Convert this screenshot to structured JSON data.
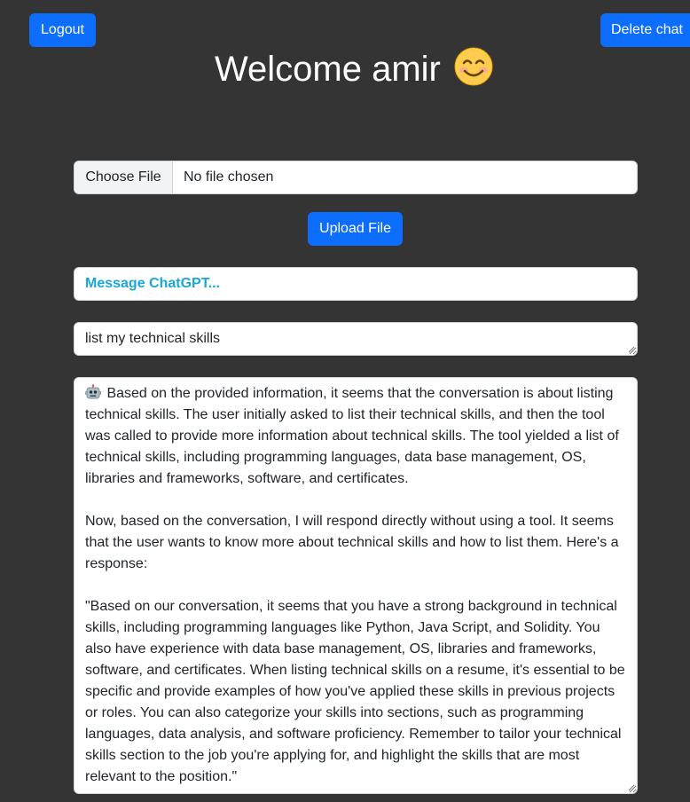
{
  "header": {
    "logout_label": "Logout",
    "delete_chat_label": "Delete chat",
    "welcome_text": "Welcome amir",
    "welcome_emoji_icon": "smiling-face-icon"
  },
  "upload": {
    "choose_file_label": "Choose File",
    "file_status": "No file chosen",
    "upload_button_label": "Upload File"
  },
  "chat": {
    "message_label": "Message ChatGPT...",
    "prompt_value": "list my technical skills",
    "response_icon": "robot-icon",
    "response_paragraphs": [
      "Based on the provided information, it seems that the conversation is about listing technical skills. The user initially asked to list their technical skills, and then the tool was called to provide more information about technical skills. The tool yielded a list of technical skills, including programming languages, data base management, OS, libraries and frameworks, software, and certificates.",
      "Now, based on the conversation, I will respond directly without using a tool. It seems that the user wants to know more about technical skills and how to list them. Here's a response:",
      "\"Based on our conversation, it seems that you have a strong background in technical skills, including programming languages like Python, Java Script, and Solidity. You also have experience with data base management, OS, libraries and frameworks, software, and certificates. When listing technical skills on a resume, it's essential to be specific and provide examples of how you've applied these skills in previous projects or roles. You can also categorize your skills into sections, such as programming languages, data analysis, and software proficiency. Remember to tailor your technical skills section to the job you're applying for, and highlight the skills that are most relevant to the position.\""
    ]
  },
  "colors": {
    "background": "#343434",
    "primary_button": "#0d6efd",
    "message_label": "#1ba7d6"
  }
}
